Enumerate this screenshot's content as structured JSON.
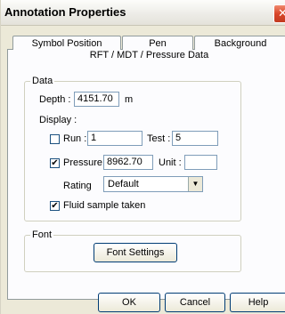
{
  "window": {
    "title": "Annotation Properties",
    "close_glyph": "✕"
  },
  "tabs": [
    {
      "label": "Symbol Position"
    },
    {
      "label": "Pen"
    },
    {
      "label": "Background"
    }
  ],
  "page_heading": "RFT / MDT / Pressure Data",
  "data_group": {
    "legend": "Data",
    "depth_label": "Depth :",
    "depth_value": "4151.70",
    "depth_unit": "m",
    "display_label": "Display :",
    "run": {
      "label": "Run :",
      "checked": false,
      "value": "1"
    },
    "test": {
      "label": "Test :",
      "value": "5"
    },
    "pressure": {
      "label": "Pressure :",
      "checked": true,
      "value": "8962.70"
    },
    "unit": {
      "label": "Unit :",
      "value": ""
    },
    "rating": {
      "label": "Rating",
      "selected": "Default"
    },
    "fluid": {
      "label": "Fluid sample taken",
      "checked": true
    }
  },
  "font_group": {
    "legend": "Font",
    "button_label": "Font Settings"
  },
  "footer": {
    "ok_label": "OK",
    "cancel_label": "Cancel",
    "help_label": "Help"
  },
  "colors": {
    "dialog_bg": "#ece9d8",
    "panel_bg": "#fcfcfe",
    "field_border": "#7f9db9",
    "close_red": "#d9462a"
  },
  "icons": {
    "checkmark": "✔",
    "dropdown": "▼"
  }
}
